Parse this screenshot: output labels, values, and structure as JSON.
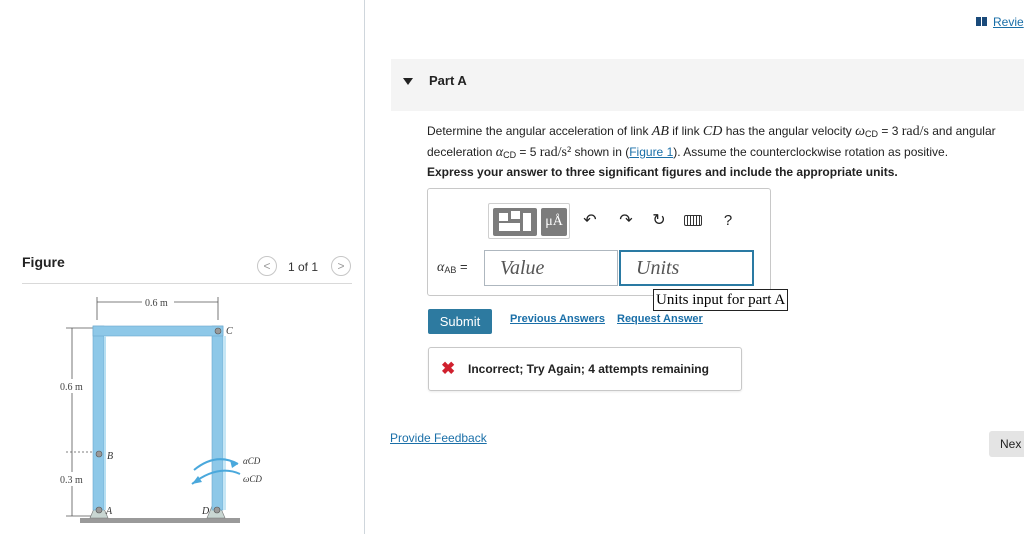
{
  "header": {
    "review_label": "Revie"
  },
  "figure_panel": {
    "title": "Figure",
    "prev_icon": "chevron-left-icon",
    "next_icon": "chevron-right-icon",
    "counter": "1 of 1",
    "diagram": {
      "dim_top": "0.6 m",
      "dim_left_upper": "0.6 m",
      "dim_left_lower": "0.3 m",
      "point_a": "A",
      "point_b": "B",
      "point_c": "C",
      "point_d": "D",
      "alpha_cd": "αCD",
      "omega_cd": "ωCD"
    }
  },
  "part": {
    "title": "Part A",
    "problem": {
      "t1": "Determine the angular acceleration of link ",
      "m_ab": "AB",
      "t2": " if link ",
      "m_cd": "CD",
      "t3": " has the angular velocity ",
      "omega": "ω",
      "omega_sub": "CD",
      "t4": " = 3 ",
      "unit_rads": "rad/s",
      "t5": " and angular",
      "t6": "deceleration ",
      "alpha": "α",
      "alpha_sub": "CD",
      "t7": " = 5 ",
      "unit_rads2": "rad/s²",
      "t8": " shown in (",
      "figure_link": "Figure 1",
      "t9": "). Assume the counterclockwise rotation as positive."
    },
    "instruction": "Express your answer to three significant figures and include the appropriate units."
  },
  "toolbar": {
    "units_button": "μÅ",
    "undo_icon": "↶",
    "redo_icon": "↷",
    "reset_icon": "↻",
    "help_label": "?"
  },
  "answer": {
    "var_label": "α",
    "var_sub": "AB",
    "equals": "=",
    "value_placeholder": "Value",
    "units_placeholder": "Units",
    "tooltip": "Units input for part A"
  },
  "actions": {
    "submit": "Submit",
    "previous_answers": "Previous Answers",
    "request_answer": "Request Answer"
  },
  "feedback": {
    "icon": "✖",
    "message": "Incorrect; Try Again; 4 attempts remaining"
  },
  "footer": {
    "provide_feedback": "Provide Feedback",
    "next": "Nex"
  },
  "colors": {
    "link": "#1a6fa8",
    "submit": "#2d7aa0",
    "error": "#d0202e",
    "frame": "#8ec8e8"
  }
}
